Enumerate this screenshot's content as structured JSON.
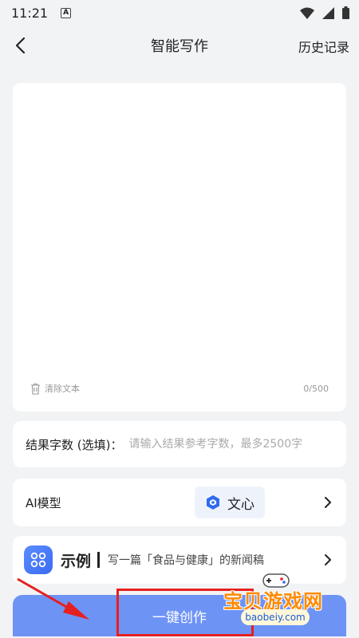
{
  "status_bar": {
    "time": "11:21",
    "notification_letter": "A"
  },
  "nav": {
    "title": "智能写作",
    "history": "历史记录"
  },
  "editor": {
    "placeholder": "",
    "clear_label": "清除文本",
    "char_count": "0/500"
  },
  "word_count": {
    "label": "结果字数 (选填)：",
    "placeholder": "请输入结果参考字数，最多2500字"
  },
  "model": {
    "label": "AI模型",
    "value": "文心"
  },
  "example": {
    "title": "示例",
    "text": "写一篇「食品与健康」的新闻稿"
  },
  "create_button": {
    "label": "一键创作"
  },
  "watermark": {
    "text": "宝贝游戏网",
    "url": "baobeiy.com"
  },
  "colors": {
    "button": "#6d93f5",
    "highlight": "#e62020",
    "arrow": "#e62020",
    "accent": "#3b6cf0"
  }
}
